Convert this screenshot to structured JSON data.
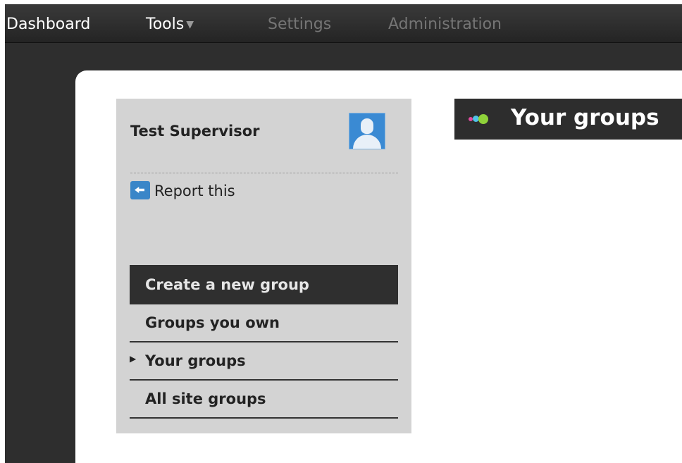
{
  "nav": {
    "items": [
      {
        "label": "Dashboard"
      },
      {
        "label": "Tools",
        "dropdown_icon": "caret-down-icon"
      },
      {
        "label": "Settings"
      },
      {
        "label": "Administration"
      }
    ]
  },
  "sidebar": {
    "profile_name": "Test Supervisor",
    "avatar_icon": "user-avatar-icon",
    "report_label": "Report this",
    "report_icon": "report-icon",
    "menu": [
      {
        "label": "Create a new group",
        "active": true
      },
      {
        "label": "Groups you own"
      },
      {
        "label": "Your groups",
        "current": true
      },
      {
        "label": "All site groups"
      }
    ]
  },
  "main": {
    "heading": "Your groups",
    "heading_icon": "colored-dots-icon"
  },
  "colors": {
    "dot_pink": "#e24aa0",
    "dot_blue": "#4fc3e8",
    "dot_green": "#8fd23a",
    "avatar_blue": "#3a8ad3"
  }
}
